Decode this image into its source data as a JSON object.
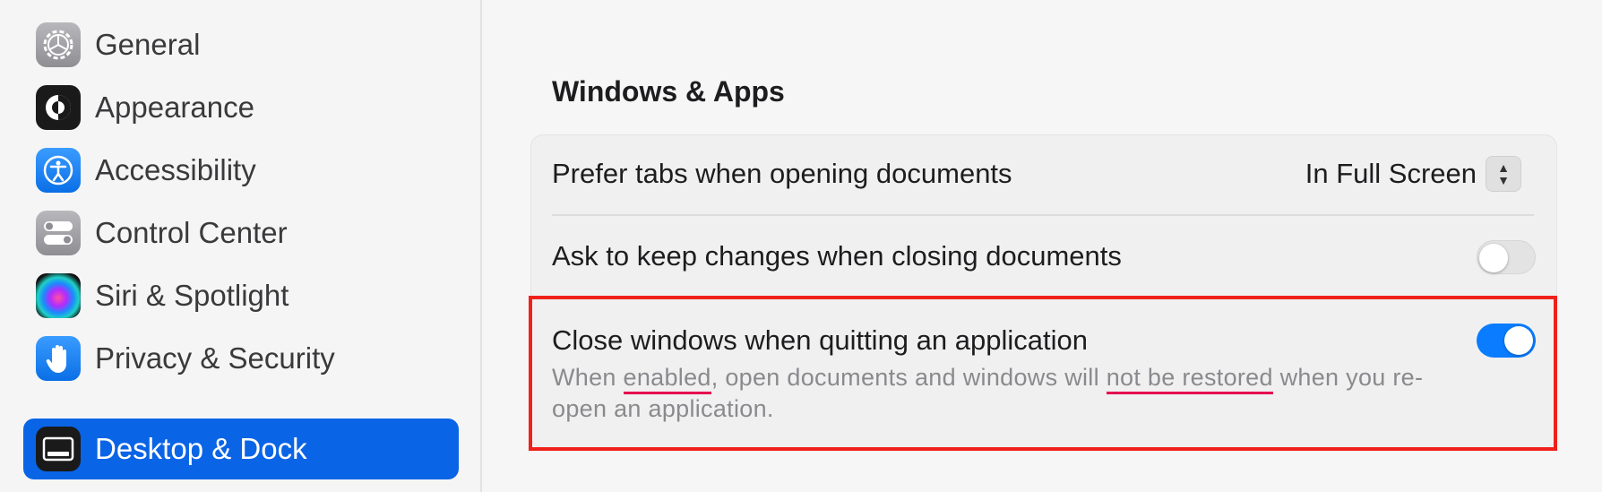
{
  "sidebar": {
    "items": [
      {
        "label": "General"
      },
      {
        "label": "Appearance"
      },
      {
        "label": "Accessibility"
      },
      {
        "label": "Control Center"
      },
      {
        "label": "Siri & Spotlight"
      },
      {
        "label": "Privacy & Security"
      },
      {
        "label": "Desktop & Dock",
        "selected": true
      }
    ]
  },
  "main": {
    "section_title": "Windows & Apps",
    "prefer_tabs": {
      "label": "Prefer tabs when opening documents",
      "value": "In Full Screen"
    },
    "ask_keep_changes": {
      "label": "Ask to keep changes when closing documents",
      "enabled": false
    },
    "close_windows": {
      "label": "Close windows when quitting an application",
      "enabled": true,
      "desc_part1": "When ",
      "desc_emph1": "enabled",
      "desc_part2": ", open documents and windows will ",
      "desc_emph2": "not be restored",
      "desc_part3": " when you re-open an application."
    }
  },
  "colors": {
    "accent": "#0a64e6",
    "toggle_on": "#0a7cff",
    "highlight": "#f0201a",
    "underline": "#e5004f"
  }
}
